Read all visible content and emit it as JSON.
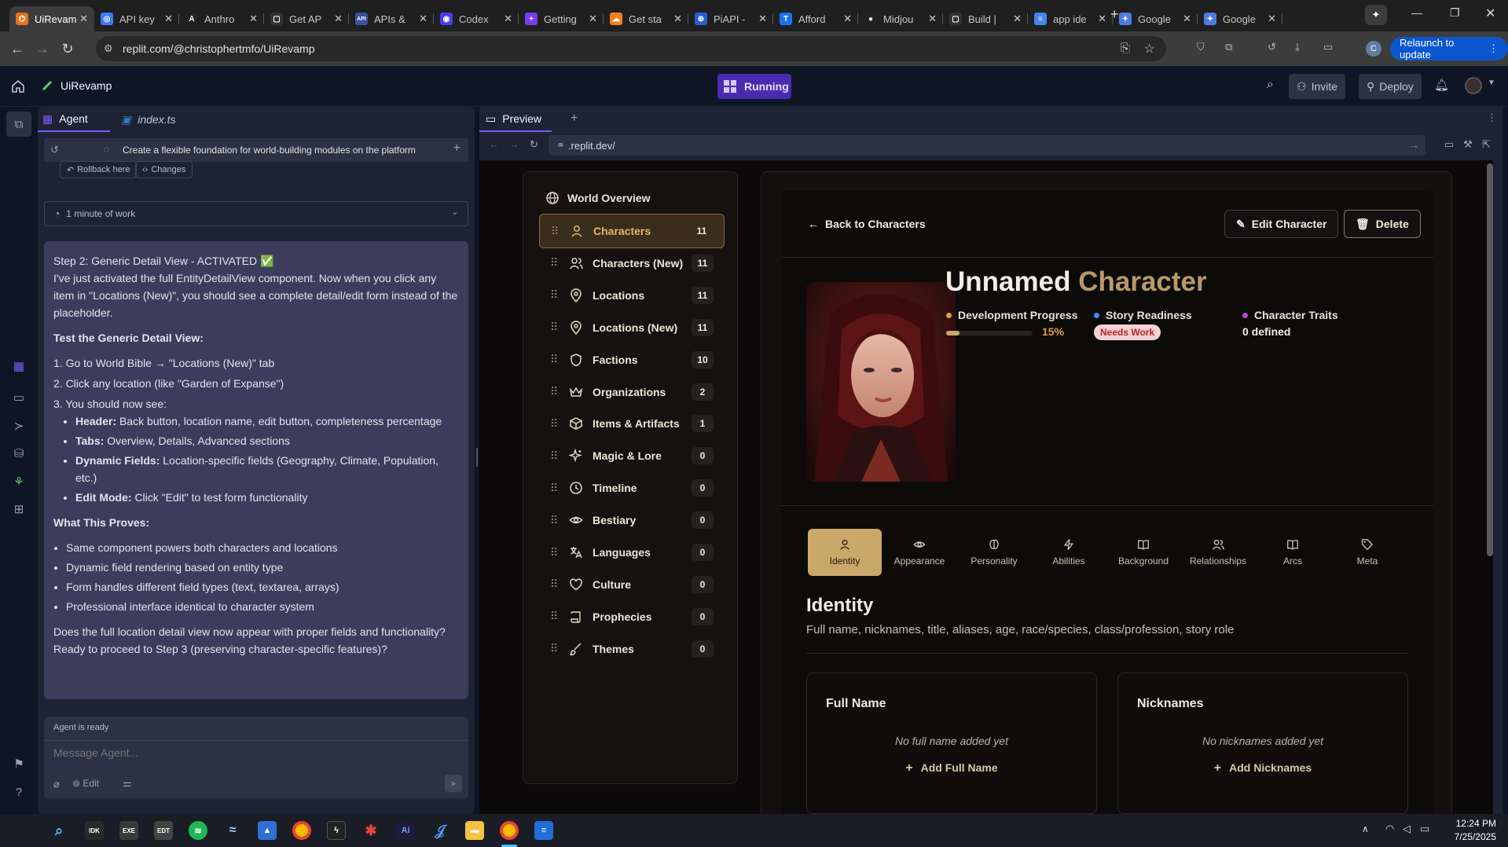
{
  "browser": {
    "tabs": [
      {
        "title": "UiRevam",
        "color": "#e8711a",
        "glyph": "⌬",
        "active": true
      },
      {
        "title": "API key",
        "color": "#3b7cff",
        "glyph": "◎"
      },
      {
        "title": "Anthro",
        "color": "#222222",
        "glyph": "A"
      },
      {
        "title": "Get AP",
        "color": "#333333",
        "glyph": "▢"
      },
      {
        "title": "APIs &",
        "color": "#3b4fa0",
        "glyph": "API"
      },
      {
        "title": "Codex",
        "color": "#4b3df0",
        "glyph": "◉"
      },
      {
        "title": "Getting",
        "color": "#7a3df0",
        "glyph": "+"
      },
      {
        "title": "Get sta",
        "color": "#f38020",
        "glyph": "☁"
      },
      {
        "title": "PiAPI -",
        "color": "#2c5bd8",
        "glyph": "⊕"
      },
      {
        "title": "Afford",
        "color": "#1a73e8",
        "glyph": "T"
      },
      {
        "title": "Midjou",
        "color": "#222222",
        "glyph": "●"
      },
      {
        "title": "Build |",
        "color": "#333333",
        "glyph": "▢"
      },
      {
        "title": "app ide",
        "color": "#4285f4",
        "glyph": "≡"
      },
      {
        "title": "Google",
        "color": "#4e7be6",
        "glyph": "✦"
      },
      {
        "title": "Google",
        "color": "#4e7be6",
        "glyph": "✦"
      }
    ],
    "url": "replit.com/@christophertmfo/UiRevamp",
    "relaunch_label": "Relaunch to update",
    "profile_initial": "C"
  },
  "replit": {
    "project_name": "UiRevamp",
    "run_label": "Running",
    "invite_label": "Invite",
    "deploy_label": "Deploy"
  },
  "agent_panel": {
    "tab_agent": "Agent",
    "tab_file": "index.ts",
    "task_title": "Create a flexible foundation for world-building modules on the platform",
    "rollback_label": "Rollback here",
    "changes_label": "Changes",
    "work_time": "1 minute of work",
    "message": {
      "step_title": "Step 2: Generic Detail View - ACTIVATED ✅",
      "intro": "I've just activated the full EntityDetailView component. Now when you click any item in \"Locations (New)\", you should see a complete detail/edit form instead of the placeholder.",
      "test_heading": "Test the Generic Detail View:",
      "steps": [
        "1. Go to World Bible → \"Locations (New)\" tab",
        "2. Click any location (like \"Garden of Expanse\")",
        "3. You should now see:"
      ],
      "see_items": [
        {
          "label": "Header:",
          "text": "Back button, location name, edit button, completeness percentage"
        },
        {
          "label": "Tabs:",
          "text": "Overview, Details, Advanced sections"
        },
        {
          "label": "Dynamic Fields:",
          "text": "Location-specific fields (Geography, Climate, Population, etc.)"
        },
        {
          "label": "Edit Mode:",
          "text": "Click \"Edit\" to test form functionality"
        }
      ],
      "proves_heading": "What This Proves:",
      "proves": [
        "Same component powers both characters and locations",
        "Dynamic field rendering based on entity type",
        "Form handles different field types (text, textarea, arrays)",
        "Professional interface identical to character system"
      ],
      "closing": "Does the full location detail view now appear with proper fields and functionality? Ready to proceed to Step 3 (preserving character-specific features)?"
    },
    "status": "Agent is ready",
    "input_placeholder": "Message Agent...",
    "edit_label": "Edit"
  },
  "preview": {
    "tab_label": "Preview",
    "url": ".replit.dev/",
    "sidebar_title": "World Overview",
    "nav": [
      {
        "label": "Characters",
        "count": "11",
        "icon": "user",
        "active": true
      },
      {
        "label": "Characters (New)",
        "count": "11",
        "icon": "users"
      },
      {
        "label": "Locations",
        "count": "11",
        "icon": "pin"
      },
      {
        "label": "Locations (New)",
        "count": "11",
        "icon": "pin"
      },
      {
        "label": "Factions",
        "count": "10",
        "icon": "shield"
      },
      {
        "label": "Organizations",
        "count": "2",
        "icon": "crown"
      },
      {
        "label": "Items & Artifacts",
        "count": "1",
        "icon": "box"
      },
      {
        "label": "Magic & Lore",
        "count": "0",
        "icon": "sparkle"
      },
      {
        "label": "Timeline",
        "count": "0",
        "icon": "clock"
      },
      {
        "label": "Bestiary",
        "count": "0",
        "icon": "eye"
      },
      {
        "label": "Languages",
        "count": "0",
        "icon": "lang"
      },
      {
        "label": "Culture",
        "count": "0",
        "icon": "heart"
      },
      {
        "label": "Prophecies",
        "count": "0",
        "icon": "scroll"
      },
      {
        "label": "Themes",
        "count": "0",
        "icon": "brush"
      }
    ],
    "detail": {
      "back_label": "Back to Characters",
      "edit_label": "Edit Character",
      "delete_label": "Delete",
      "name_part1": "Unnamed ",
      "name_part2": "Character",
      "stats": {
        "progress_label": "Development Progress",
        "progress_value": "15%",
        "progress_fraction": 0.15,
        "readiness_label": "Story Readiness",
        "readiness_badge": "Needs Work",
        "traits_label": "Character Traits",
        "traits_value": "0 defined"
      },
      "tabs": [
        {
          "label": "Identity",
          "icon": "user",
          "active": true
        },
        {
          "label": "Appearance",
          "icon": "eye"
        },
        {
          "label": "Personality",
          "icon": "brain"
        },
        {
          "label": "Abilities",
          "icon": "bolt"
        },
        {
          "label": "Background",
          "icon": "book"
        },
        {
          "label": "Relationships",
          "icon": "users"
        },
        {
          "label": "Arcs",
          "icon": "book"
        },
        {
          "label": "Meta",
          "icon": "tag"
        }
      ],
      "section_title": "Identity",
      "section_desc": "Full name, nicknames, title, aliases, age, race/species, class/profession, story role",
      "cards": [
        {
          "title": "Full Name",
          "empty": "No full name added yet",
          "add": "Add Full Name"
        },
        {
          "title": "Nicknames",
          "empty": "No nicknames added yet",
          "add": "Add Nicknames"
        }
      ]
    }
  },
  "taskbar": {
    "time": "12:24 PM",
    "date": "7/25/2025"
  },
  "colors": {
    "accent_gold": "#c9a86a",
    "badge_red": "#f6d3d3",
    "running_purple": "#6b3fd8",
    "chat_bg": "#3c3d5c"
  }
}
